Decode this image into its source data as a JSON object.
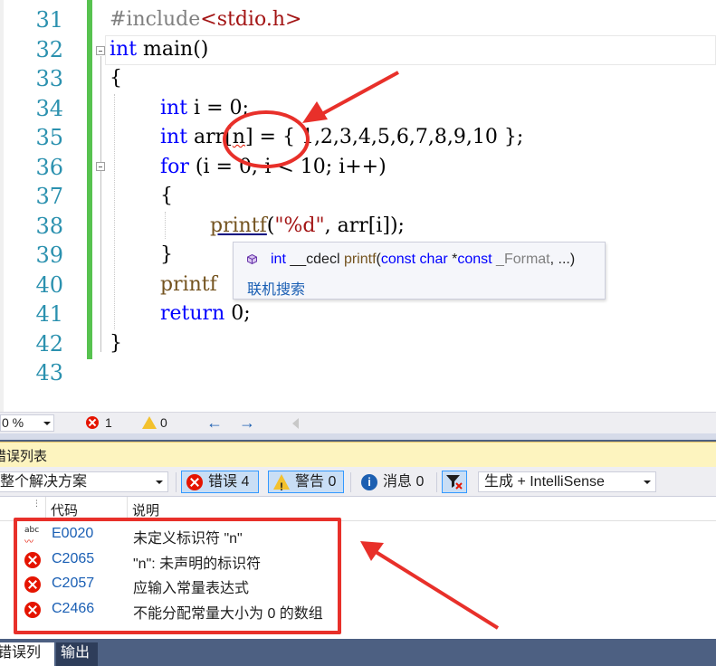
{
  "editor": {
    "lines": [
      {
        "num": "31",
        "text": "#include<stdio.h>"
      },
      {
        "num": "32",
        "text": "int main()"
      },
      {
        "num": "33",
        "text": "{"
      },
      {
        "num": "34",
        "text": "int i = 0;"
      },
      {
        "num": "35",
        "text": "int arr[n] = { 1,2,3,4,5,6,7,8,9,10 };"
      },
      {
        "num": "36",
        "text": "for (i = 0; i < 10; i++)"
      },
      {
        "num": "37",
        "text": "{"
      },
      {
        "num": "38",
        "text": "printf(\"%d\", arr[i]);"
      },
      {
        "num": "39",
        "text": "}"
      },
      {
        "num": "40",
        "text": "printf"
      },
      {
        "num": "41",
        "text": "return 0;"
      },
      {
        "num": "42",
        "text": "}"
      },
      {
        "num": "43",
        "text": ""
      }
    ],
    "tokens": {
      "pp": "#include",
      "inc": "<stdio.h>",
      "kw_int": "int",
      "main": " main()",
      "brace_open": "{",
      "brace_close": "}",
      "decl_i": " i = 0;",
      "arr_pre": " arr[",
      "arr_n": "n",
      "arr_post": "] = { 1,2,3,4,5,6,7,8,9,10 };",
      "kw_for": "for",
      "for_rest": " (i = 0; i < 10; i++)",
      "printf": "printf",
      "paren_open": "(",
      "fmt": "\"%d\"",
      "printf_rest": ", arr[i]);",
      "printf_partial": "printf",
      "kw_return": "return",
      "return_rest": " 0;"
    },
    "tooltip": {
      "kw1": "int",
      "cc": " __cdecl ",
      "fn": "printf",
      "open": "(",
      "kw2": "const",
      "kw3": " char",
      "star": " *",
      "kw4": "const",
      "param": " _Format",
      "rest": ", ...)",
      "link": "联机搜索"
    }
  },
  "status_bar": {
    "zoom": "0 %",
    "error_count": "1",
    "warning_count": "0",
    "back_arrow": "←",
    "forward_arrow": "→"
  },
  "error_list": {
    "title": "错误列表",
    "scope": "整个解决方案",
    "errors_btn": "错误 4",
    "warnings_btn": "警告 0",
    "messages_btn": "消息 0",
    "source": "生成 + IntelliSense",
    "col_code": "代码",
    "col_desc": "说明",
    "rows": [
      {
        "code": "E0020",
        "desc": "未定义标识符 \"n\"",
        "icon": "spell-check-icon"
      },
      {
        "code": "C2065",
        "desc": "\"n\": 未声明的标识符",
        "icon": "error-icon"
      },
      {
        "code": "C2057",
        "desc": "应输入常量表达式",
        "icon": "error-icon"
      },
      {
        "code": "C2466",
        "desc": "不能分配常量大小为 0 的数组",
        "icon": "error-icon"
      }
    ]
  },
  "bottom_tabs": [
    "错误列表",
    "输出"
  ],
  "colors": {
    "keyword": "#0000ff",
    "string": "#a31515",
    "line_number": "#2b91af",
    "change_bar": "#57c24f",
    "annotation": "#e8302a",
    "error": "#e51400"
  }
}
